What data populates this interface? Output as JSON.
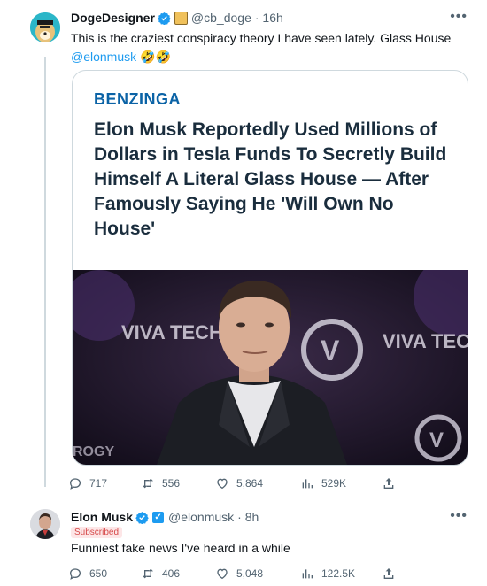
{
  "tweet1": {
    "name": "DogeDesigner",
    "handle": "@cb_doge",
    "time": "· 16h",
    "text": "This is the craziest conspiracy theory I have seen lately. Glass House",
    "mention": "@elonmusk",
    "emoji": "🤣🤣",
    "card": {
      "brand": "BENZINGA",
      "headline": "Elon Musk Reportedly Used Millions of Dollars in Tesla Funds To Secretly Build Himself A Literal Glass House — After Famously Saying He 'Will Own No House'",
      "photo_sign_left": "VIVA TECHNO",
      "photo_sign_right": "VIVA TECHNO",
      "photo_sign_bottom": "ROGY"
    },
    "stats": {
      "replies": "717",
      "retweets": "556",
      "likes": "5,864",
      "views": "529K"
    }
  },
  "tweet2": {
    "name": "Elon Musk",
    "handle": "@elonmusk",
    "time": "· 8h",
    "badge": "Subscribed",
    "text": "Funniest fake news I've heard in a while",
    "stats": {
      "replies": "650",
      "retweets": "406",
      "likes": "5,048",
      "views": "122.5K"
    }
  },
  "colors": {
    "verified": "#1d9bf0",
    "link": "#1d9bf0",
    "brand": "#0b63a6",
    "muted": "#536471"
  }
}
